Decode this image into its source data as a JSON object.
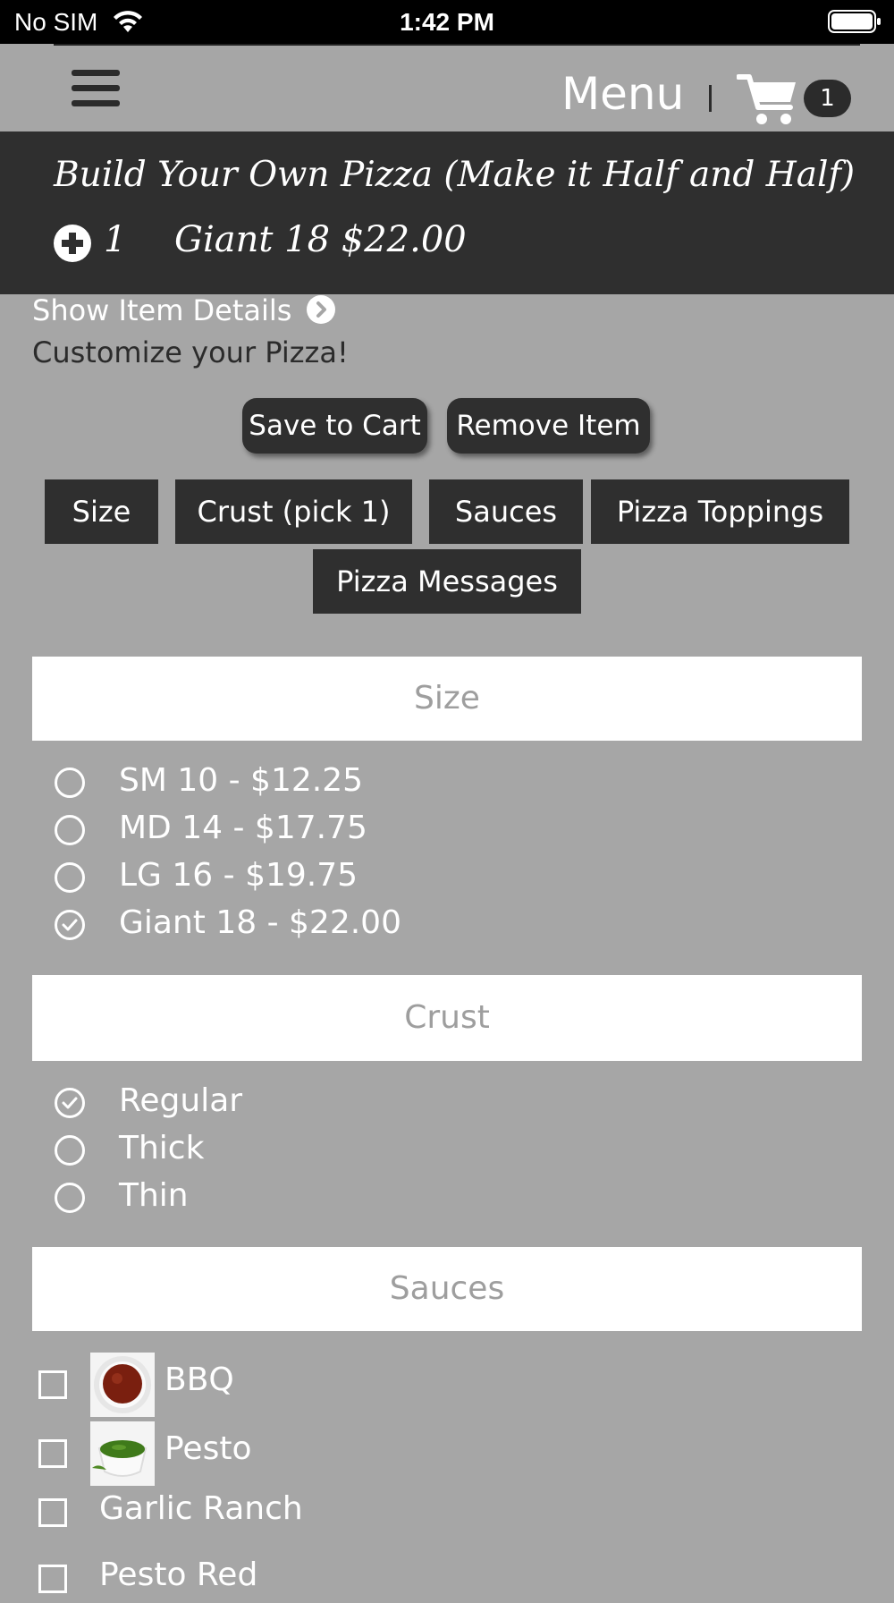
{
  "status_bar": {
    "carrier": "No SIM",
    "time": "1:42 PM"
  },
  "nav": {
    "menu_label": "Menu",
    "cart_count": "1"
  },
  "item": {
    "title": "Build Your Own Pizza (Make it Half and Half)",
    "quantity": "1",
    "size_price": "Giant 18 $22.00",
    "show_details": "Show Item Details",
    "customize": "Customize your Pizza!"
  },
  "actions": {
    "save": "Save to Cart",
    "remove": "Remove Item"
  },
  "tabs": [
    "Size",
    "Crust (pick 1)",
    "Sauces",
    "Pizza Toppings",
    "Pizza Messages"
  ],
  "sections": {
    "size": {
      "title": "Size",
      "options": [
        {
          "label": "SM 10 - $12.25",
          "selected": false
        },
        {
          "label": "MD 14 - $17.75",
          "selected": false
        },
        {
          "label": "LG 16 - $19.75",
          "selected": false
        },
        {
          "label": "Giant 18 - $22.00",
          "selected": true
        }
      ]
    },
    "crust": {
      "title": "Crust",
      "options": [
        {
          "label": "Regular",
          "selected": true
        },
        {
          "label": "Thick",
          "selected": false
        },
        {
          "label": "Thin",
          "selected": false
        }
      ]
    },
    "sauces": {
      "title": "Sauces",
      "options": [
        {
          "label": "BBQ",
          "checked": false
        },
        {
          "label": "Pesto",
          "checked": false
        },
        {
          "label": "Garlic Ranch",
          "checked": false
        },
        {
          "label": "Pesto Red",
          "checked": false
        }
      ]
    }
  },
  "colors": {
    "background": "#a6a6a6",
    "dark": "#2f2f2f",
    "white": "#ffffff",
    "section_title": "#9e9e9e"
  }
}
